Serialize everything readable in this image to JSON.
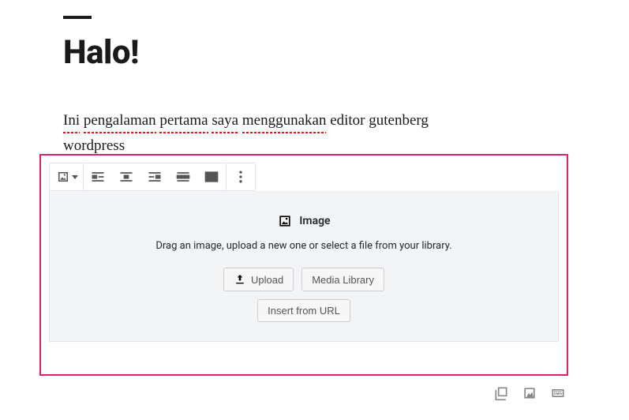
{
  "post": {
    "title": "Halo!",
    "paragraph_words": [
      "Ini",
      "pengalaman",
      "pertama",
      "saya",
      "menggunakan",
      "editor",
      "gutenberg",
      "wordpress"
    ],
    "misspelled_indices": [
      0,
      1,
      2,
      3,
      4,
      7
    ]
  },
  "toolbar": {
    "block_type": "image",
    "alignments": [
      "align-left",
      "align-center",
      "align-right",
      "align-wide",
      "align-full"
    ]
  },
  "placeholder": {
    "title": "Image",
    "instructions": "Drag an image, upload a new one or select a file from your library.",
    "upload_label": "Upload",
    "media_library_label": "Media Library",
    "insert_url_label": "Insert from URL"
  },
  "footer_buttons": [
    "gallery",
    "image",
    "keyboard"
  ]
}
